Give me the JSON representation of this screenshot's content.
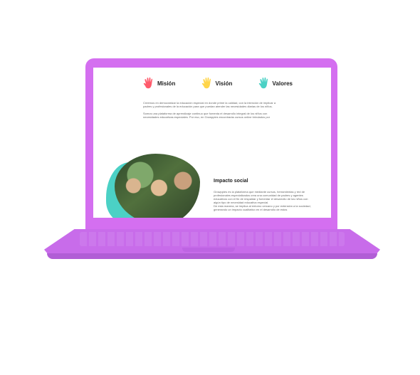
{
  "tabs": [
    {
      "label": "Misión",
      "icon": "hand-icon",
      "color": "#ff5b6c"
    },
    {
      "label": "Visión",
      "icon": "hand-icon",
      "color": "#ffd54a"
    },
    {
      "label": "Valores",
      "icon": "hand-icon",
      "color": "#4bd1c5"
    }
  ],
  "content": {
    "para1": "Creemos en democratizar la educación especial en donde prime la calidad, con la intención de implicar a padres y profesionales de la educación para que puedan atender las necesidades diarias de los niños.",
    "para2": "Somos una plataforma de aprendizaje continuo que fomenta el desarrollo integral de los niños con necesidades educativas especiales. Por eso, en Growppies encontrarás cursos online brindados por"
  },
  "impact": {
    "title": "Impacto social",
    "text1": "Growppies es la plataforma que mediante cursos, herramientas y red de profesionales especializados crea una comunidad de padres y agentes educativos con el fin de respaldar y fomentar el desarrollo de los niños con algún tipo de necesidad educativa especial.",
    "text2": "De esta manera, se implica al entorno cercano y por extensión a la sociedad, generando un impacto cualitativo en el desarrollo de estos"
  },
  "colors": {
    "laptop": "#d46ff0",
    "accent_teal": "#4bd1c5"
  }
}
